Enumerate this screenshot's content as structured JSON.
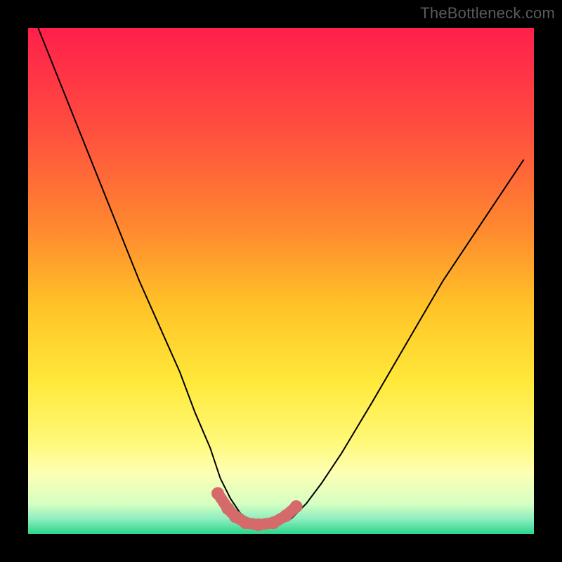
{
  "watermark": "TheBottleneck.com",
  "chart_data": {
    "type": "line",
    "title": "",
    "xlabel": "",
    "ylabel": "",
    "xlim": [
      0,
      100
    ],
    "ylim": [
      0,
      100
    ],
    "grid": false,
    "legend": false,
    "background": {
      "kind": "vertical_gradient",
      "stops": [
        {
          "pos": 0.0,
          "color": "#ff1f4b"
        },
        {
          "pos": 0.2,
          "color": "#ff4e3f"
        },
        {
          "pos": 0.4,
          "color": "#ff8a2f"
        },
        {
          "pos": 0.55,
          "color": "#ffc327"
        },
        {
          "pos": 0.7,
          "color": "#ffe93a"
        },
        {
          "pos": 0.82,
          "color": "#fff97a"
        },
        {
          "pos": 0.88,
          "color": "#fdffb4"
        },
        {
          "pos": 0.94,
          "color": "#d6ffc1"
        },
        {
          "pos": 0.97,
          "color": "#8feec0"
        },
        {
          "pos": 1.0,
          "color": "#2bd68a"
        }
      ]
    },
    "series": [
      {
        "name": "bottleneck-curve",
        "stroke": "#000000",
        "stroke_width": 2,
        "x": [
          2,
          6,
          10,
          14,
          18,
          22,
          26,
          30,
          33,
          36,
          38,
          40,
          42,
          45,
          48,
          52,
          55,
          58,
          62,
          68,
          75,
          82,
          90,
          98
        ],
        "y": [
          100,
          90,
          80,
          70,
          60,
          50,
          41,
          32,
          24,
          17,
          11,
          7,
          4,
          2,
          2,
          3,
          6,
          10,
          16,
          26,
          38,
          50,
          62,
          74
        ]
      }
    ],
    "markers": {
      "name": "valley-trace",
      "color": "#d46a6a",
      "radius_path_width": 16,
      "x": [
        37.5,
        39.5,
        41.0,
        43.0,
        45.5,
        48.5,
        51.0,
        53.0
      ],
      "y": [
        8.0,
        5.0,
        3.4,
        2.2,
        1.8,
        2.2,
        3.6,
        5.4
      ]
    }
  }
}
